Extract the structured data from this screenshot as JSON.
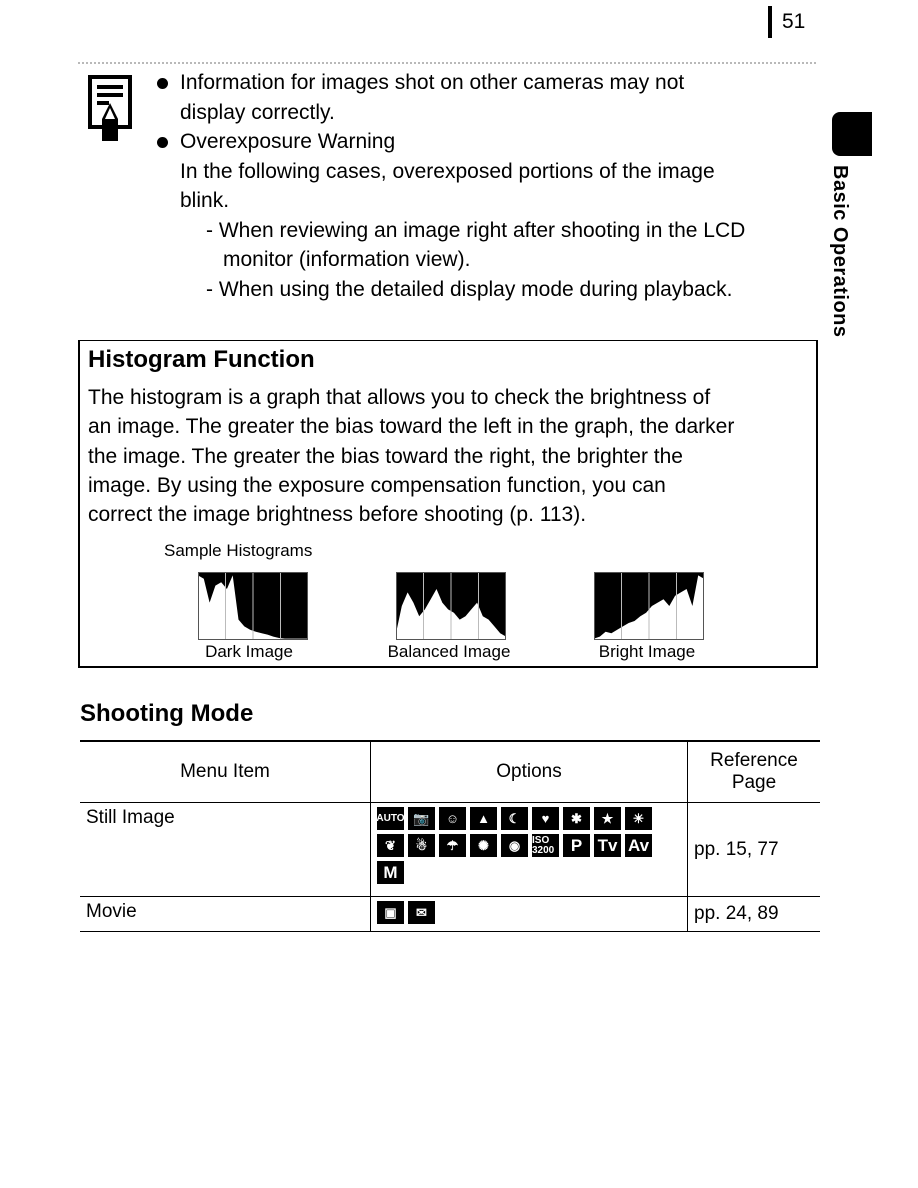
{
  "page_number": "51",
  "side_tab": {
    "label": "Basic Operations"
  },
  "note": {
    "icon": "memo-pencil-icon",
    "bullets": [
      {
        "lines": [
          "Information for images shot on other cameras may not",
          "display correctly."
        ]
      },
      {
        "title": "Overexposure Warning",
        "lines": [
          "In the following cases, overexposed portions of the image",
          "blink."
        ],
        "sub_items": [
          {
            "lines": [
              "- When reviewing an image right after shooting in the LCD",
              "monitor (information view)."
            ]
          },
          {
            "lines": [
              "- When using the detailed display mode during playback."
            ]
          }
        ]
      }
    ]
  },
  "histogram_box": {
    "title": "Histogram Function",
    "body_lines": [
      "The histogram is a graph that allows you to check the brightness of",
      "an image. The greater the bias toward the left in the graph, the darker",
      "the image. The greater the bias toward the right, the brighter the",
      "image. By using the exposure compensation function, you can",
      "correct the image brightness before shooting (p. 113)."
    ],
    "samples_label": "Sample Histograms",
    "samples": [
      {
        "caption": "Dark Image",
        "profile": [
          0.95,
          0.9,
          0.55,
          0.8,
          0.85,
          0.75,
          0.95,
          0.3,
          0.2,
          0.15,
          0.12,
          0.1,
          0.08,
          0.05,
          0.03,
          0.02,
          0.02,
          0.02,
          0.02,
          0.02
        ]
      },
      {
        "caption": "Balanced Image",
        "profile": [
          0.1,
          0.5,
          0.7,
          0.55,
          0.35,
          0.45,
          0.6,
          0.75,
          0.55,
          0.45,
          0.4,
          0.3,
          0.35,
          0.45,
          0.55,
          0.35,
          0.3,
          0.2,
          0.1,
          0.05
        ]
      },
      {
        "caption": "Bright Image",
        "profile": [
          0.02,
          0.05,
          0.12,
          0.1,
          0.15,
          0.2,
          0.25,
          0.28,
          0.35,
          0.4,
          0.5,
          0.55,
          0.6,
          0.5,
          0.65,
          0.7,
          0.75,
          0.5,
          0.95,
          0.9
        ]
      }
    ]
  },
  "shooting_mode": {
    "title": "Shooting Mode",
    "headers": [
      "Menu Item",
      "Options",
      "Reference Page"
    ],
    "header_ref_lines": [
      "Reference",
      "Page"
    ],
    "rows": [
      {
        "item": "Still Image",
        "options": [
          "AUTO",
          "camera-icon",
          "portrait-icon",
          "landscape-icon",
          "night-scene-icon",
          "kids-pets-icon",
          "indoor-party-icon",
          "night-snapshot-icon",
          "sunset-icon",
          "foliage-icon",
          "snow-icon",
          "beach-icon",
          "fireworks-icon",
          "aquarium-icon",
          "ISO 3200",
          "P",
          "Tv",
          "Av",
          "M"
        ],
        "ref": "pp. 15, 77"
      },
      {
        "item": "Movie",
        "options": [
          "movie-standard-icon",
          "movie-email-icon"
        ],
        "ref": "pp. 24, 89"
      }
    ]
  }
}
